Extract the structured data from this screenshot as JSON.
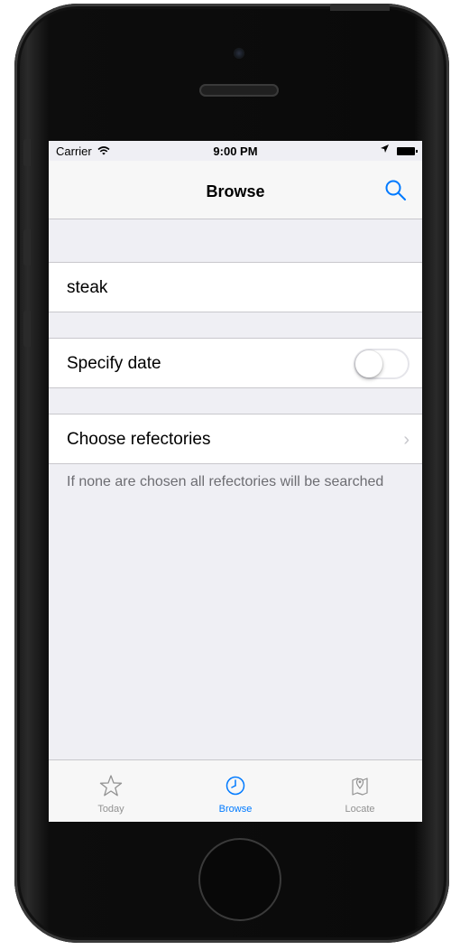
{
  "status": {
    "carrier": "Carrier",
    "time": "9:00 PM"
  },
  "nav": {
    "title": "Browse"
  },
  "search": {
    "value": "steak"
  },
  "date_row": {
    "label": "Specify date",
    "toggle_on": false
  },
  "refectories_row": {
    "label": "Choose refectories",
    "hint": "If none are chosen all refectories will be searched"
  },
  "tabs": [
    {
      "label": "Today",
      "icon": "star-icon",
      "active": false
    },
    {
      "label": "Browse",
      "icon": "clock-icon",
      "active": true
    },
    {
      "label": "Locate",
      "icon": "map-pin-icon",
      "active": false
    }
  ],
  "colors": {
    "accent": "#007aff",
    "background": "#efeff4",
    "inactive": "#929292"
  }
}
